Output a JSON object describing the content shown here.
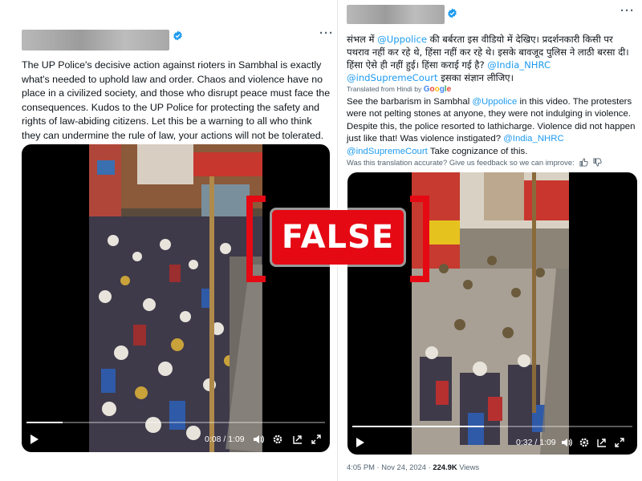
{
  "left_tweet": {
    "text": "The UP Police's decisive action against rioters in Sambhal is exactly what's needed to uphold law and order. Chaos and violence have no place in a civilized society, and those who disrupt peace must face the consequences. Kudos to the UP Police for protecting the safety and rights of law-abiding citizens. Let this be a warning to all who think they can undermine the rule of law, your actions will not be tolerated.",
    "video": {
      "time": "0:08 / 1:09",
      "progress": 0.12
    }
  },
  "right_tweet": {
    "hindi": {
      "p1": "संभल में ",
      "mention1": "@Uppolice",
      "p2": " की बर्बरता इस वीडियो में देखिए। प्रदर्शनकारी किसी पर पथराव नहीं कर रहे थे, हिंसा नहीं कर रहे थे। इसके बावजूद पुलिस ने लाठी बरसा दी। हिंसा ऐसे ही नहीं हुई। हिंसा कराई गई है? ",
      "mention2": "@India_NHRC",
      "mention3": "@indSupremeCourt",
      "p3": " इसका संज्ञान लीजिए।"
    },
    "translated_label": "Translated from Hindi by",
    "google": [
      "G",
      "o",
      "o",
      "g",
      "l",
      "e"
    ],
    "google_colors": [
      "#4285f4",
      "#ea4335",
      "#fbbc05",
      "#4285f4",
      "#34a853",
      "#ea4335"
    ],
    "translation": {
      "p1": "See the barbarism in Sambhal ",
      "mention1": "@Uppolice",
      "p2": " in this video. The protesters were not pelting stones at anyone, they were not indulging in violence. Despite this, the police resorted to lathicharge. Violence did not happen just like that! Was violence instigated? ",
      "mention2": "@India_NHRC",
      "mention3": "@indSupremeCourt",
      "p3": "Take cognizance of this."
    },
    "feedback": "Was this translation accurate? Give us feedback so we can improve:",
    "video": {
      "time": "0:32 / 1:09",
      "progress": 0.47
    },
    "meta": {
      "timestamp": "4:05 PM · Nov 24, 2024 · ",
      "views": "224.9K",
      "views_label": " Views"
    }
  },
  "stamp": {
    "label": "FALSE"
  },
  "colors": {
    "accent": "#1d9bf0",
    "stamp": "#e50914",
    "muted": "#536471"
  }
}
